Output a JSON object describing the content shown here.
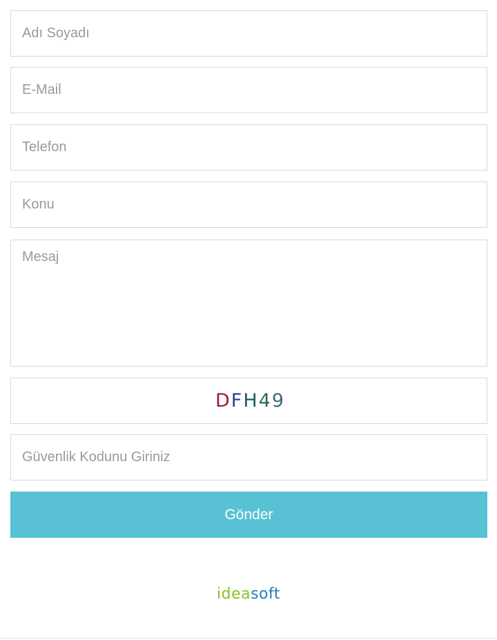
{
  "form": {
    "name": {
      "placeholder": "Adı Soyadı",
      "value": ""
    },
    "email": {
      "placeholder": "E-Mail",
      "value": ""
    },
    "phone": {
      "placeholder": "Telefon",
      "value": ""
    },
    "subject": {
      "placeholder": "Konu",
      "value": ""
    },
    "message": {
      "placeholder": "Mesaj",
      "value": ""
    },
    "captcha": {
      "chars": [
        {
          "char": "D",
          "color": "#9c1b3e"
        },
        {
          "char": "F",
          "color": "#28458e"
        },
        {
          "char": "H",
          "color": "#1f5a5e"
        },
        {
          "char": "4",
          "color": "#2e6a52"
        },
        {
          "char": "9",
          "color": "#3b6d74"
        }
      ]
    },
    "security_code": {
      "placeholder": "Güvenlik Kodunu Giriniz",
      "value": ""
    },
    "submit_label": "Gönder",
    "submit_color": "#58c2d4"
  },
  "footer": {
    "brand_part1": "idea",
    "brand_part1_color": "#8bc21e",
    "brand_part2": "soft",
    "brand_part2_color": "#1f7fb4"
  }
}
